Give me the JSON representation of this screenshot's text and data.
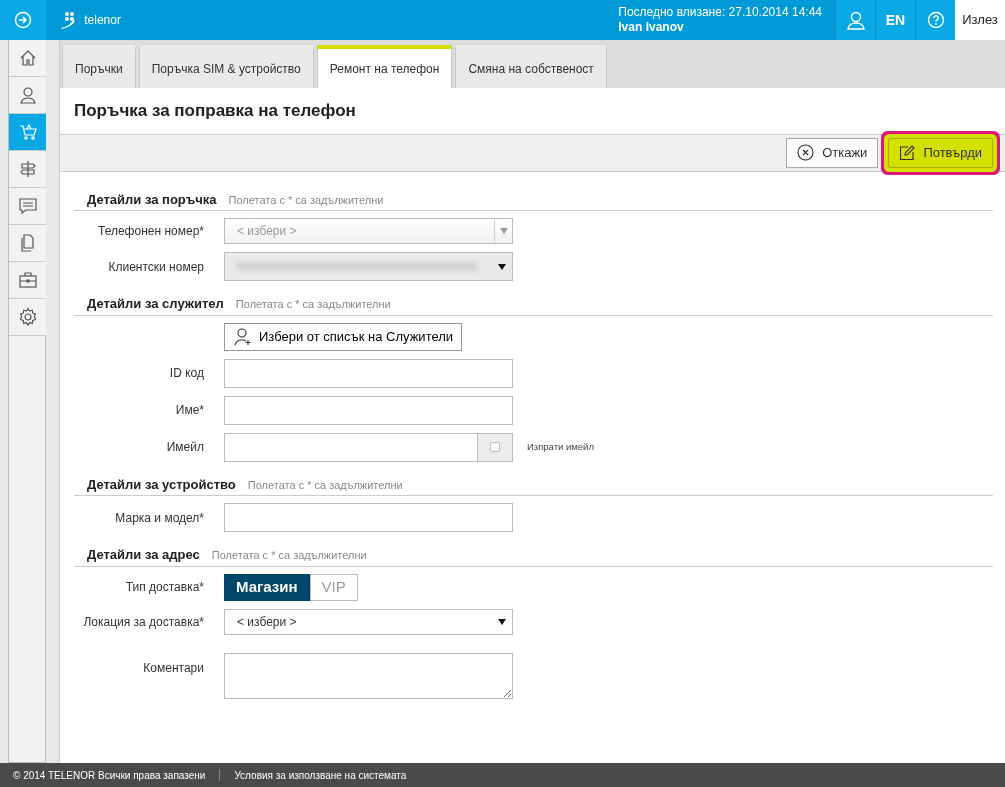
{
  "header": {
    "brand": "telenor",
    "last_login": "Последно влизане: 27.10.2014 14:44",
    "user": "Ivan Ivanov",
    "language": "EN",
    "logout": "Излез"
  },
  "sidebar": {
    "items": [
      {
        "kind": "home",
        "selected": false
      },
      {
        "kind": "user",
        "selected": false
      },
      {
        "kind": "cart",
        "selected": true
      },
      {
        "kind": "signpost",
        "selected": false
      },
      {
        "kind": "chat",
        "selected": false
      },
      {
        "kind": "documents",
        "selected": false
      },
      {
        "kind": "briefcase",
        "selected": false
      },
      {
        "kind": "settings",
        "selected": false
      }
    ]
  },
  "tabs": [
    {
      "label": "Поръчки",
      "selected": false
    },
    {
      "label": "Поръчка SIM & устройство",
      "selected": false
    },
    {
      "label": "Ремонт на телефон",
      "selected": true
    },
    {
      "label": "Смяна на собственост",
      "selected": false
    }
  ],
  "title": "Поръчка за поправка на телефон",
  "actions": [
    {
      "kind": "cancel",
      "label": "Откажи",
      "highlighted": false
    },
    {
      "kind": "confirm",
      "label": "Потвърди",
      "highlighted": true
    }
  ],
  "sections": [
    {
      "title": "Детайли за поръчка",
      "note": "Полетата с * са задължителни",
      "fields": [
        {
          "kind": "select",
          "label": "Телефонен номер*",
          "placeholder": "< избери >",
          "disabled": true
        },
        {
          "kind": "select",
          "label": "Клиентски номер",
          "redacted": true,
          "disabled": false
        }
      ]
    },
    {
      "title": "Детайли за служител",
      "note": "Полетата с * са задължителни",
      "fields": [
        {
          "kind": "button",
          "label": "Избери от списък на Служители"
        },
        {
          "kind": "text",
          "label": "ID код"
        },
        {
          "kind": "text",
          "label": "Име*"
        },
        {
          "kind": "email",
          "label": "Имейл",
          "checkbox_label": "Изпрати имейл",
          "checked": false
        }
      ]
    },
    {
      "title": "Детайли за устройство",
      "note": "Полетата с * са задължителни",
      "fields": [
        {
          "kind": "text",
          "label": "Марка и модел*"
        }
      ]
    },
    {
      "title": "Детайли за адрес",
      "note": "Полетата с * са задължителни",
      "fields": [
        {
          "kind": "toggle",
          "label": "Тип доставка*",
          "options": [
            {
              "label": "Магазин",
              "selected": true
            },
            {
              "label": "VIP",
              "selected": false
            }
          ]
        },
        {
          "kind": "select",
          "label": "Локация за доставка*",
          "placeholder": "< избери >",
          "disabled": false
        },
        {
          "kind": "textarea",
          "label": "Коментари"
        }
      ]
    }
  ],
  "footer": {
    "copyright": "© 2014 TELENOR Всички права запазени",
    "terms": "Условия за използване на системата"
  }
}
